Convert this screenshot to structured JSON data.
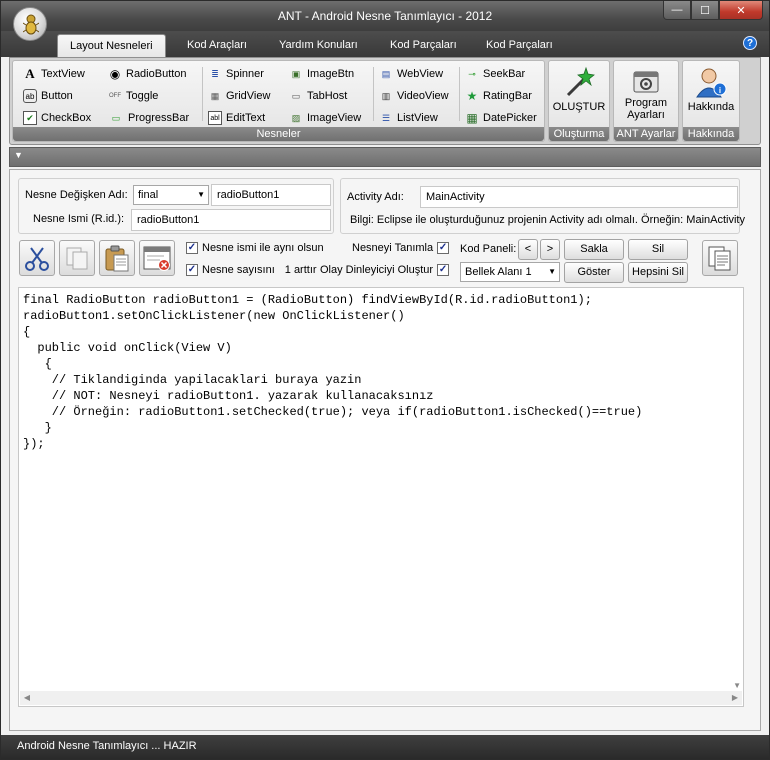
{
  "window": {
    "title": "ANT - Android Nesne Tanımlayıcı - 2012",
    "min_glyph": "—",
    "max_glyph": "☐",
    "close_glyph": "✕"
  },
  "tabs": [
    {
      "label": "Layout Nesneleri",
      "active": true
    },
    {
      "label": "Kod Araçları"
    },
    {
      "label": "Yardım Konuları"
    },
    {
      "label": "Kod Parçaları"
    },
    {
      "label": "Kod Parçaları"
    }
  ],
  "help_glyph": "?",
  "ribbon": {
    "nesneler_label": "Nesneler",
    "items": [
      {
        "label": "TextView",
        "icon": "A",
        "icon_name": "textview-icon"
      },
      {
        "label": "Button",
        "icon": "ab",
        "icon_name": "button-icon"
      },
      {
        "label": "CheckBox",
        "icon": "✔",
        "icon_name": "checkbox-icon"
      },
      {
        "label": "RadioButton",
        "icon": "◉",
        "icon_name": "radiobutton-icon"
      },
      {
        "label": "Toggle",
        "icon": "OFF",
        "icon_name": "toggle-icon"
      },
      {
        "label": "ProgressBar",
        "icon": "▭",
        "icon_name": "progressbar-icon"
      },
      {
        "label": "Spinner",
        "icon": "≣",
        "icon_name": "spinner-icon"
      },
      {
        "label": "GridView",
        "icon": "▦",
        "icon_name": "gridview-icon"
      },
      {
        "label": "EditText",
        "icon": "abl",
        "icon_name": "edittext-icon"
      },
      {
        "label": "ImageBtn",
        "icon": "▣",
        "icon_name": "imagebtn-icon"
      },
      {
        "label": "TabHost",
        "icon": "▭",
        "icon_name": "tabhost-icon"
      },
      {
        "label": "ImageView",
        "icon": "▨",
        "icon_name": "imageview-icon"
      },
      {
        "label": "WebView",
        "icon": "▤",
        "icon_name": "webview-icon"
      },
      {
        "label": "VideoView",
        "icon": "▥",
        "icon_name": "videoview-icon"
      },
      {
        "label": "ListView",
        "icon": "☰",
        "icon_name": "listview-icon"
      },
      {
        "label": "SeekBar",
        "icon": "⊸",
        "icon_name": "seekbar-icon"
      },
      {
        "label": "RatingBar",
        "icon": "★",
        "icon_name": "ratingbar-icon"
      },
      {
        "label": "DatePicker",
        "icon": "▦",
        "icon_name": "datepicker-icon"
      }
    ],
    "olustur": {
      "label": "OLUŞTUR",
      "group": "Oluşturma"
    },
    "program": {
      "label1": "Program",
      "label2": "Ayarları",
      "group": "ANT Ayarlar"
    },
    "hakkinda": {
      "label": "Hakkında",
      "group": "Hakkında"
    }
  },
  "collapse_glyph": "▼",
  "form": {
    "degisken_label": "Nesne Değişken Adı:",
    "degisken_type": "final",
    "degisken_value": "radioButton1",
    "isim_label": "Nesne Ismi (R.id.):",
    "isim_value": "radioButton1",
    "activity_label": "Activity Adı:",
    "activity_value": "MainActivity",
    "bilgi": "Bilgi: Eclipse ile oluşturduğunuz projenin Activity adı olmalı. Örneğin: MainActivity"
  },
  "options": {
    "ayni_isim": "Nesne ismi ile aynı olsun",
    "sayisi": "Nesne sayısını",
    "sayisi_count": "1 arttır",
    "tanimla": "Nesneyi Tanımla",
    "dinleyici": "Olay Dinleyiciyi Oluştur",
    "check_glyph": "✓"
  },
  "kod_panel": {
    "label": "Kod Paneli:",
    "prev": "<",
    "next": ">",
    "bellek": "Bellek Alanı 1",
    "sakla": "Sakla",
    "sil": "Sil",
    "goster": "Göster",
    "hepsini_sil": "Hepsini Sil"
  },
  "code": "final RadioButton radioButton1 = (RadioButton) findViewById(R.id.radioButton1);\nradioButton1.setOnClickListener(new OnClickListener()\n{\n  public void onClick(View V)\n   {\n    // Tiklandiginda yapilacaklari buraya yazin\n    // NOT: Nesneyi radioButton1. yazarak kullanacaksınız\n    // Örneğin: radioButton1.setChecked(true); veya if(radioButton1.isChecked()==true)\n   }\n});",
  "scroll": {
    "left": "◀",
    "right": "▶",
    "down": "▼"
  },
  "status": "Android Nesne Tanımlayıcı ... HAZIR",
  "colors": {
    "title_bar": "#4a4a4a",
    "accent_blue": "#1e6fd6"
  }
}
